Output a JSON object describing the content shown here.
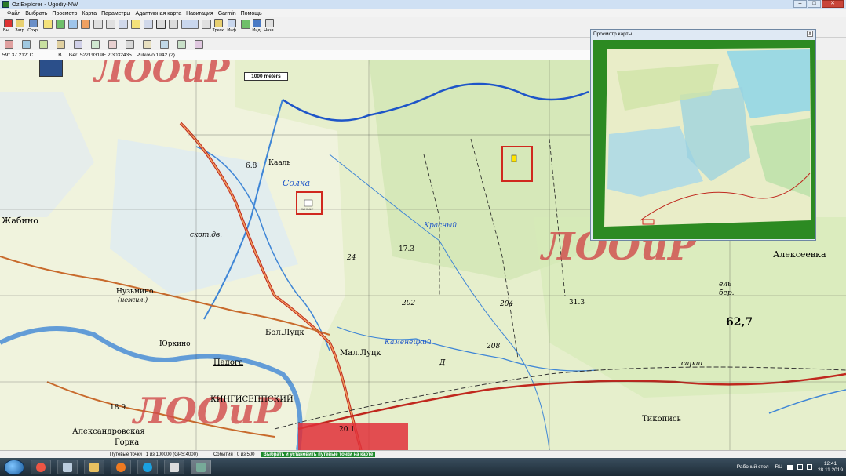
{
  "window": {
    "title": "OziExplorer - Ugodiy-NW",
    "controls": [
      "–",
      "□",
      "✕"
    ]
  },
  "menu": [
    "Файл",
    "Выбрать",
    "Просмотр",
    "Карта",
    "Параметры",
    "Адаптивная карта",
    "Навигация",
    "Garmin",
    "Помощь"
  ],
  "toolbar": {
    "labeled": [
      {
        "icon": "exit-icon",
        "label": "Вы..."
      },
      {
        "icon": "load-icon",
        "label": "Загр."
      },
      {
        "icon": "save-icon",
        "label": "Сохр."
      }
    ],
    "extra_labeled": [
      {
        "icon": "track-icon",
        "label": "Треск."
      },
      {
        "icon": "info-icon",
        "label": "Инф."
      },
      {
        "icon": "indicator-icon",
        "label": "Инд."
      },
      {
        "icon": "name-icon",
        "label": "Назв."
      }
    ]
  },
  "coords": {
    "lat": "59° 37.212' С",
    "extra": "В",
    "user": "User: 52219319E  2.3032435",
    "datum": "Pulkovo 1942 (2)"
  },
  "map": {
    "scale_label": "1000 meters",
    "stamp_text": "ЛООиР",
    "labels": [
      {
        "text": "Жабино",
        "size": 11
      },
      {
        "text": "6.8",
        "size": 9
      },
      {
        "text": "Нузьмино",
        "size": 9
      },
      {
        "text": "(нежил.)",
        "size": 8
      },
      {
        "text": "Юркино",
        "size": 9
      },
      {
        "text": "Бол.Луцк",
        "size": 10
      },
      {
        "text": "Мал.Луцк",
        "size": 10
      },
      {
        "text": "Падога",
        "size": 10
      },
      {
        "text": "КИНГИСЕППСКИЙ",
        "size": 10
      },
      {
        "text": "Александровская",
        "size": 10
      },
      {
        "text": "Горка",
        "size": 10
      },
      {
        "text": "Солка",
        "size": 11
      },
      {
        "text": "Кааль",
        "size": 9
      },
      {
        "text": "Красный",
        "size": 9
      },
      {
        "text": "Каменецкий",
        "size": 9
      },
      {
        "text": "Тикопись",
        "size": 10
      },
      {
        "text": "Алексеевка",
        "size": 11
      },
      {
        "text": "62,7",
        "size": 14
      },
      {
        "text": "17.3",
        "size": 9
      },
      {
        "text": "31.3",
        "size": 9
      },
      {
        "text": "202",
        "size": 9
      },
      {
        "text": "204",
        "size": 9
      },
      {
        "text": "208",
        "size": 9
      },
      {
        "text": "24",
        "size": 9
      },
      {
        "text": "20.1",
        "size": 9
      },
      {
        "text": "18.9",
        "size": 9
      },
      {
        "text": "сараи",
        "size": 9
      },
      {
        "text": "скот.дв.",
        "size": 9
      },
      {
        "text": "ель",
        "size": 9
      },
      {
        "text": "бер.",
        "size": 9
      },
      {
        "text": "Д",
        "size": 9
      }
    ],
    "waypoint_label": "WHINLY"
  },
  "preview": {
    "title": "Просмотр карты",
    "close": "x"
  },
  "status": {
    "waypoints": "Путевые точки : 1 из 100000  (GPS:4000)",
    "events": "События : 0 из 500",
    "hint": "Выбрать и установить путевые точки на карте"
  },
  "taskbar": {
    "apps": [
      "explorer-icon",
      "notes-icon",
      "files-icon",
      "firefox-icon",
      "skype-icon",
      "film-icon",
      "ozi-icon"
    ],
    "desktop_label": "Рабочий стол",
    "lang": "RU",
    "time": "12:41",
    "date": "28.11.2019"
  },
  "colors": {
    "accent": "#1d8a2c",
    "stamp": "#d14a4a",
    "water": "#3f86d6",
    "road": "#c86a2c"
  }
}
